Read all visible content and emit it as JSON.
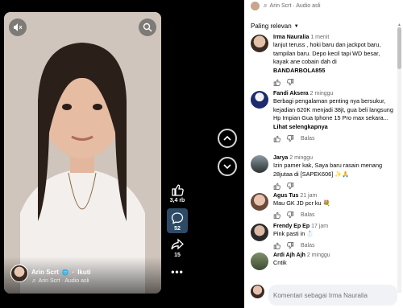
{
  "video": {
    "author_name": "Arin Scrt",
    "follow_label": "Ikuti",
    "audio_label": "♬ Arin Scrt · Audio asli",
    "like_count": "3,4 rb",
    "comment_count": "52",
    "share_count": "15",
    "more": "•••"
  },
  "comments_header": {
    "audio_label": "♬ Arin Scrt · Audio asli",
    "sort_label": "Paling relevan"
  },
  "comments": [
    {
      "name": "Irma Nauralia",
      "time": "1 menit",
      "text": "lanjut teruss , hoki baru dan jackpot baru, tampilan baru. Depo kecil tapi WD besar, kayak ane cobain dah di",
      "strong": "BANDARBOLA855"
    },
    {
      "name": "Fandi Aksera",
      "time": "2 minggu",
      "text": "Berbagi pengalaman penting nya bersukur, kejadian 620K menjadi 38jt, gua beli langsung Hp Impian Gua Iphone 15 Pro max sekara...",
      "strong": "Lihat selengkapnya"
    },
    {
      "name": "Jarya",
      "time": "2 minggu",
      "text": "Izin pamer kak, Saya baru rasain menang 28jutaa di [SAPEK606] ✨🙏",
      "strong": ""
    },
    {
      "name": "Agus Tus",
      "time": "21 jam",
      "text": "Mau GK JD pcr ku 💐",
      "strong": ""
    },
    {
      "name": "Frendy Ep Ep",
      "time": "17 jam",
      "text": "Pink pasti in 🥼",
      "strong": ""
    },
    {
      "name": "Ardi Ajh Ajh",
      "time": "2 minggu",
      "text": "Cntik",
      "strong": ""
    }
  ],
  "reply_label": "Balas",
  "compose": {
    "placeholder": "Komentari sebagai Irma Nauralia"
  },
  "colors": {
    "accent": "#2d4b66",
    "text": "#050505",
    "muted": "#65676b"
  }
}
